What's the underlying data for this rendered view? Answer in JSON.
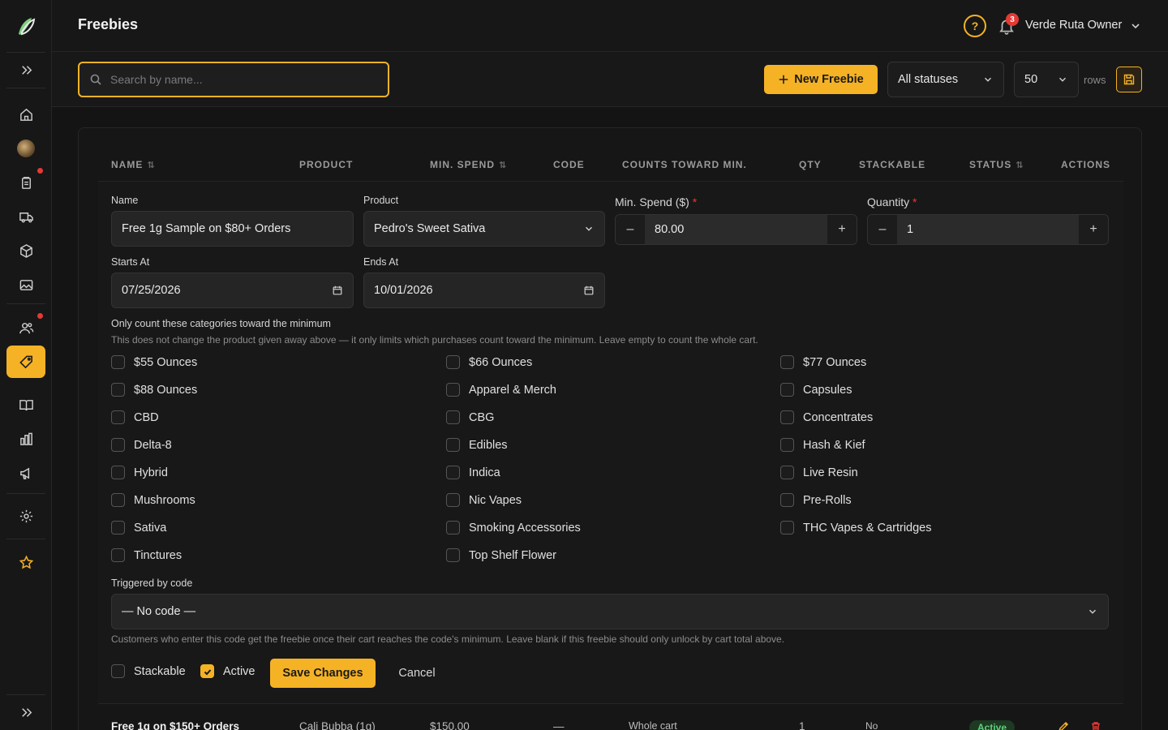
{
  "header": {
    "title": "Freebies",
    "help_label": "?",
    "notifications_count": "3",
    "user": "Verde Ruta Owner"
  },
  "toolbar": {
    "search_placeholder": "Search by name...",
    "search_value": "",
    "new_label": "New Freebie",
    "status_filter": "All statuses",
    "rows_value": "50",
    "rows_label": "rows"
  },
  "table": {
    "columns": [
      "NAME",
      "PRODUCT",
      "MIN. SPEND",
      "CODE",
      "COUNTS TOWARD MIN.",
      "QTY",
      "STACKABLE",
      "STATUS",
      "ACTIONS"
    ],
    "rows": [
      {
        "name": "Free 1g on $150+ Orders",
        "product": "Cali Bubba (1g)",
        "min_spend": "$150.00",
        "code": "—",
        "counts": "Whole cart",
        "qty": "1",
        "stackable": "No",
        "status": "Active"
      }
    ]
  },
  "editor": {
    "name_label": "Name",
    "name_value": "Free 1g Sample on $80+ Orders",
    "product_label": "Product",
    "product_value": "Pedro's Sweet Sativa",
    "min_spend_label": "Min. Spend ($)",
    "min_spend_value": "80.00",
    "quantity_label": "Quantity",
    "quantity_value": "1",
    "required_mark": "*",
    "minus": "–",
    "plus": "+",
    "starts_label": "Starts At",
    "starts_value": "07/25/2026",
    "ends_label": "Ends At",
    "ends_value": "10/01/2026",
    "categories_label": "Only count these categories toward the minimum",
    "categories_help": "This does not change the product given away above — it only limits which purchases count toward the minimum. Leave empty to count the whole cart.",
    "categories": [
      "$55 Ounces",
      "$66 Ounces",
      "$77 Ounces",
      "$88 Ounces",
      "Apparel & Merch",
      "Capsules",
      "CBD",
      "CBG",
      "Concentrates",
      "Delta-8",
      "Edibles",
      "Hash & Kief",
      "Hybrid",
      "Indica",
      "Live Resin",
      "Mushrooms",
      "Nic Vapes",
      "Pre-Rolls",
      "Sativa",
      "Smoking Accessories",
      "THC Vapes & Cartridges",
      "Tinctures",
      "Top Shelf Flower"
    ],
    "code_label": "Triggered by code",
    "code_value": "— No code —",
    "code_help": "Customers who enter this code get the freebie once their cart reaches the code's minimum. Leave blank if this freebie should only unlock by cart total above.",
    "stackable_label": "Stackable",
    "stackable_checked": false,
    "active_label": "Active",
    "active_checked": true,
    "save_label": "Save Changes",
    "cancel_label": "Cancel"
  },
  "colors": {
    "accent": "#f5b225",
    "background": "#141414",
    "danger": "#e53935",
    "success": "#5fd07a"
  }
}
